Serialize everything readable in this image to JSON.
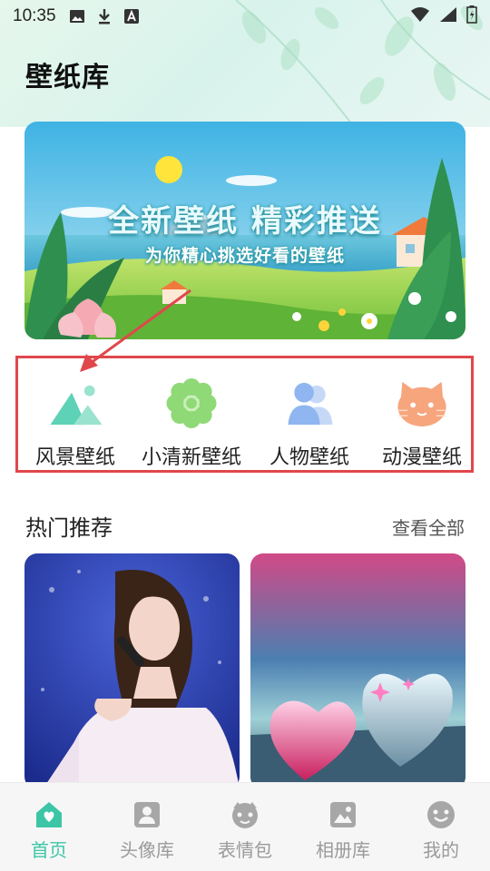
{
  "status_bar": {
    "time": "10:35"
  },
  "app": {
    "title": "壁纸库"
  },
  "banner": {
    "title": "全新壁纸 精彩推送",
    "subtitle": "为你精心挑选好看的壁纸"
  },
  "categories": [
    {
      "label": "风景壁纸",
      "icon": "mountain-icon"
    },
    {
      "label": "小清新壁纸",
      "icon": "flower-icon"
    },
    {
      "label": "人物壁纸",
      "icon": "people-icon"
    },
    {
      "label": "动漫壁纸",
      "icon": "cat-icon"
    }
  ],
  "hot": {
    "title": "热门推荐",
    "more": "查看全部"
  },
  "bottom_nav": [
    {
      "label": "首页",
      "icon": "home-icon",
      "active": true
    },
    {
      "label": "头像库",
      "icon": "avatar-icon",
      "active": false
    },
    {
      "label": "表情包",
      "icon": "emoji-face-icon",
      "active": false
    },
    {
      "label": "相册库",
      "icon": "album-icon",
      "active": false
    },
    {
      "label": "我的",
      "icon": "smile-icon",
      "active": false
    }
  ],
  "colors": {
    "accent": "#3cc6a6",
    "highlight_border": "#e0474c",
    "inactive": "#9a9a9a"
  }
}
